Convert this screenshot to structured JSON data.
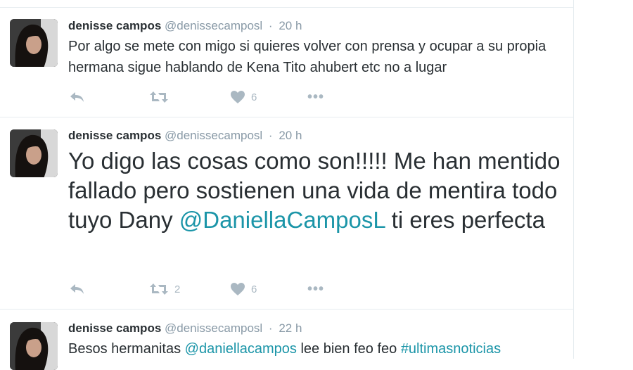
{
  "tweets": [
    {
      "name": "denisse campos",
      "handle": "@denissecamposl",
      "separator": "·",
      "time": "20 h",
      "text": "Por algo se mete con migo si quieres volver con prensa y ocupar a su propia hermana sigue hablando de Kena Tito ahubert etc no a lugar",
      "retweets": "",
      "likes": "6",
      "more": "•••"
    },
    {
      "name": "denisse campos",
      "handle": "@denissecamposl",
      "separator": "·",
      "time": "20 h",
      "text_before": "Yo digo las cosas como son!!!!! Me han mentido fallado pero sostienen una vida de mentira todo tuyo Dany ",
      "mention": "@DaniellaCamposL",
      "text_after": " ti eres perfecta",
      "retweets": "2",
      "likes": "6",
      "more": "•••"
    },
    {
      "name": "denisse campos",
      "handle": "@denissecamposl",
      "separator": "·",
      "time": "22 h",
      "text_before": "Besos hermanitas ",
      "mention": "@daniellacampos",
      "text_middle": " lee bien feo feo ",
      "hashtag": "#ultimasnoticias"
    }
  ],
  "icons": {
    "reply": "reply-icon",
    "retweet": "retweet-icon",
    "like": "heart-icon",
    "more": "more-icon"
  },
  "colors": {
    "link": "#1b95a8",
    "muted": "#8899a6",
    "icon": "#aab8c2",
    "text": "#292f33"
  }
}
